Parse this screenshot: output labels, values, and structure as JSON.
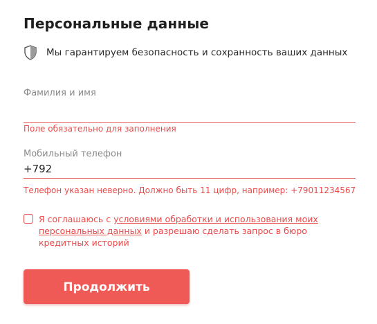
{
  "header": {
    "title": "Персональные данные",
    "security_note": "Мы гарантируем безопасность и сохранность ваших данных",
    "security_icon": "shield-icon"
  },
  "form": {
    "name_field": {
      "label": "Фамилия и имя",
      "value": "",
      "error": "Поле обязательно для заполнения"
    },
    "phone_field": {
      "label": "Мобильный телефон",
      "value": "+792",
      "error": "Телефон указан неверно. Должно быть 11 цифр, например: +79011234567"
    },
    "consent": {
      "checked": false,
      "text_before": "Я соглашаюсь с ",
      "link_text": "условиями обработки и использования моих персональных данных",
      "text_after": " и разрешаю сделать запрос в бюро кредитных историй"
    },
    "submit_label": "Продолжить"
  },
  "colors": {
    "error": "#ea4a4a",
    "button": "#f05a56",
    "label": "#8a8a8a"
  }
}
